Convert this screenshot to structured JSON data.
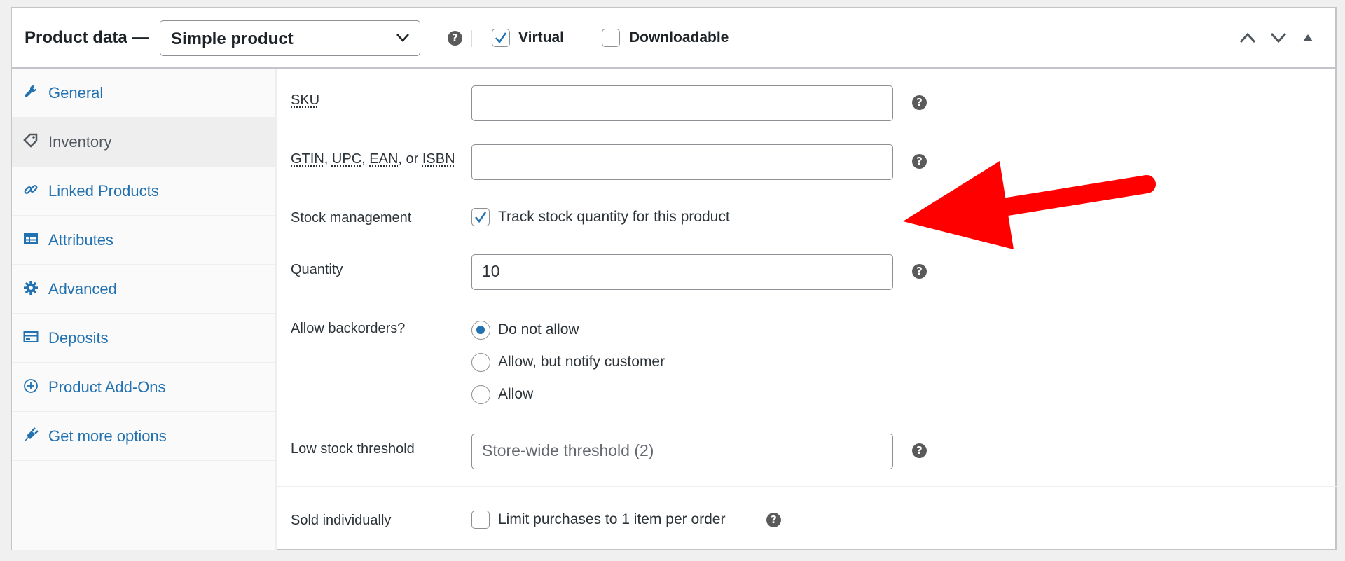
{
  "header": {
    "title": "Product data —",
    "product_type": "Simple product",
    "help_icon": "?",
    "virtual_label": "Virtual",
    "virtual_checked": true,
    "downloadable_label": "Downloadable",
    "downloadable_checked": false,
    "icons": [
      "chevron-up-icon",
      "chevron-down-icon",
      "collapse-triangle-icon"
    ]
  },
  "sidebar": {
    "items": [
      {
        "label": "General",
        "icon": "wrench-icon",
        "active": false
      },
      {
        "label": "Inventory",
        "icon": "tag-icon",
        "active": true
      },
      {
        "label": "Linked Products",
        "icon": "link-icon",
        "active": false
      },
      {
        "label": "Attributes",
        "icon": "table-icon",
        "active": false
      },
      {
        "label": "Advanced",
        "icon": "gear-icon",
        "active": false
      },
      {
        "label": "Deposits",
        "icon": "credit-card-icon",
        "active": false
      },
      {
        "label": "Product Add-Ons",
        "icon": "plus-circle-icon",
        "active": false
      },
      {
        "label": "Get more options",
        "icon": "plugin-icon",
        "active": false
      }
    ]
  },
  "form": {
    "sku": {
      "label": "SKU",
      "value": ""
    },
    "gtin": {
      "label_parts": [
        "GTIN",
        ", ",
        "UPC",
        ", ",
        "EAN",
        ", or ",
        "ISBN"
      ],
      "value": ""
    },
    "stock_management": {
      "label": "Stock management",
      "checkbox_label": "Track stock quantity for this product",
      "checked": true
    },
    "quantity": {
      "label": "Quantity",
      "value": "10"
    },
    "backorders": {
      "label": "Allow backorders?",
      "options": [
        "Do not allow",
        "Allow, but notify customer",
        "Allow"
      ],
      "selected": "Do not allow"
    },
    "low_stock": {
      "label": "Low stock threshold",
      "placeholder": "Store-wide threshold (2)"
    },
    "sold_individually": {
      "label": "Sold individually",
      "checkbox_label": "Limit purchases to 1 item per order",
      "checked": false
    }
  },
  "colors": {
    "accent": "#2271b1",
    "annotation_arrow": "#ff0000"
  }
}
